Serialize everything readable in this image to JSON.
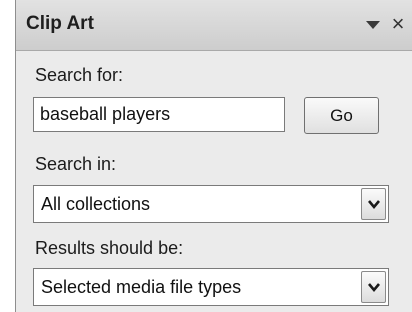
{
  "pane": {
    "title": "Clip Art"
  },
  "search": {
    "label": "Search for:",
    "value": "baseball players",
    "go_label": "Go"
  },
  "search_in": {
    "label": "Search in:",
    "selected": "All collections"
  },
  "results": {
    "label": "Results should be:",
    "selected": "Selected media file types"
  },
  "icons": {
    "pane_menu": "chevron-down-icon",
    "pane_close": "close-icon",
    "dropdown": "dropdown-arrow-icon"
  }
}
